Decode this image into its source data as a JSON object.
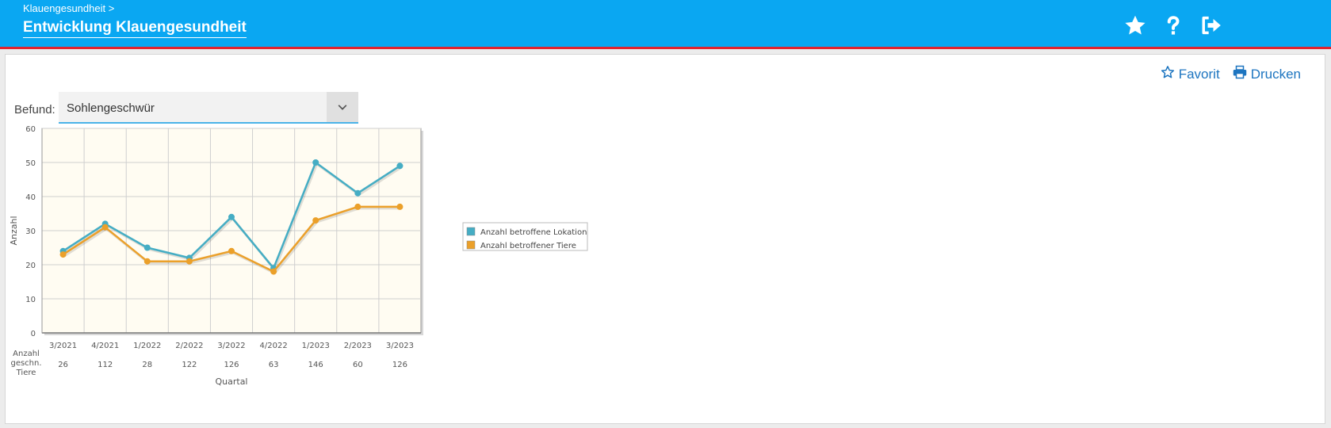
{
  "header": {
    "breadcrumb": "Klauengesundheit >",
    "title": "Entwicklung Klauengesundheit",
    "icons": [
      "star-icon",
      "help-icon",
      "logout-icon"
    ]
  },
  "actions": {
    "favorit": "Favorit",
    "drucken": "Drucken"
  },
  "filter": {
    "label": "Befund:",
    "value": "Sohlengeschwür"
  },
  "colors": {
    "header": "#0aa7f2",
    "accent_line": "#e4232f",
    "link": "#1d75c0",
    "series_lokation": "#45adc4",
    "series_tiere": "#eba02a",
    "plot_bg": "#fffcf2"
  },
  "chart_data": {
    "type": "line",
    "categories": [
      "3/2021",
      "4/2021",
      "1/2022",
      "2/2022",
      "3/2022",
      "4/2022",
      "1/2023",
      "2/2023",
      "3/2023"
    ],
    "series": [
      {
        "name": "Anzahl betroffene Lokation",
        "values": [
          24,
          32,
          25,
          22,
          34,
          19,
          50,
          41,
          49
        ]
      },
      {
        "name": "Anzahl betroffener Tiere",
        "values": [
          23,
          31,
          21,
          21,
          24,
          18,
          33,
          37,
          37
        ]
      }
    ],
    "extra_row": {
      "label": "Anzahl geschn. Tiere",
      "label_lines": [
        "Anzahl",
        "geschn.",
        "Tiere"
      ],
      "values": [
        "26",
        "112",
        "28",
        "122",
        "126",
        "63",
        "146",
        "60",
        "126"
      ]
    },
    "xlabel": "Quartal",
    "ylabel": "Anzahl",
    "ylim": [
      0,
      60
    ],
    "yticks": [
      0,
      10,
      20,
      30,
      40,
      50,
      60
    ],
    "grid": true,
    "legend": "right"
  }
}
